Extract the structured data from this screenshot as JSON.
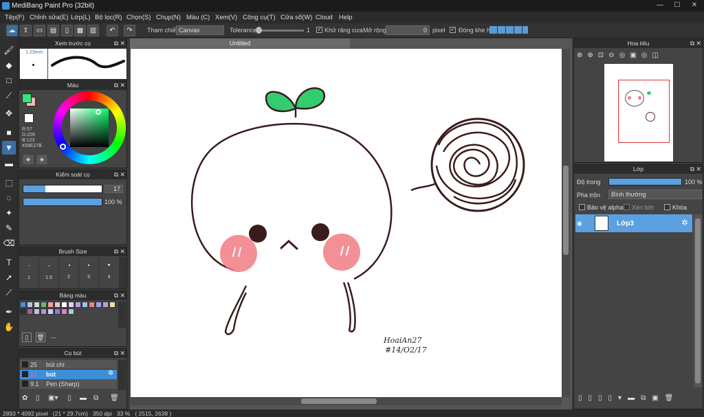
{
  "window": {
    "title": "MediBang Paint Pro (32bit)",
    "min": "—",
    "max": "☐",
    "close": "✕"
  },
  "menu": [
    "Tệp(F)",
    "Chỉnh sửa(E)",
    "Lớp(L)",
    "Bộ lọc(R)",
    "Chọn(S)",
    "Chụp(N)",
    "Màu (C)",
    "Xem(V)",
    "Công cụ(T)",
    "Cửa sổ(W)",
    "Cloud",
    "Help"
  ],
  "toolbar": {
    "reference_label": "Tham chiếu",
    "reference_value": "Canvas",
    "tolerance_label": "Tolerance",
    "tolerance_value": "1",
    "antialias_label": "Khử răng cưa",
    "expand_label": "Mở rộng",
    "expand_value": "0",
    "expand_unit": "pixel",
    "close_gap_label": "Đóng khe hở"
  },
  "brush_preview": {
    "title": "Xem trước cọ",
    "size": "1.23mm"
  },
  "color_panel": {
    "title": "Màu",
    "r": "R:57",
    "g": "G:226",
    "b": "B:123",
    "hex": "#39E27B",
    "primary": "#39E27B",
    "secondary": "#f5b8b8"
  },
  "brush_control": {
    "title": "Kiểm soát cọ",
    "size_value": "17",
    "opacity_value": "100 %",
    "size_fraction": 0.28,
    "opacity_fraction": 1.0
  },
  "brush_size": {
    "title": "Brush Size",
    "sizes": [
      "1",
      "1.5",
      "2",
      "3",
      "4"
    ]
  },
  "palette": {
    "title": "Bảng màu",
    "add_label": "---",
    "colors": [
      "#4a8fd8",
      "#b0c8e8",
      "#d8d8d8",
      "#60c060",
      "#f0a0a0",
      "#f0c0d0",
      "#ffffff",
      "#e0d0f0",
      "#c0a0e0",
      "#a0c0f0",
      "#f08080",
      "#a0a0f0",
      "#c0a0d0",
      "#f0e0a0",
      "#303030",
      "#a060a0",
      "#c0c0f0",
      "#a0a0d0",
      "#d0d0f0",
      "#8080e0",
      "#e080c0",
      "#a0d0e0"
    ]
  },
  "brushes": {
    "title": "Cọ bút",
    "items": [
      {
        "size": "25",
        "name": "bút chì"
      },
      {
        "size": "17",
        "name": "bút"
      },
      {
        "size": "9.1",
        "name": "Pen (Sharp)"
      }
    ]
  },
  "canvas": {
    "tab": "Untitled",
    "signature_line1": "HoaiAn27",
    "signature_line2": "#14/O2/17"
  },
  "navigator": {
    "title": "Hoa tiêu"
  },
  "layers": {
    "title": "Lớp",
    "opacity_label": "Độ trong",
    "opacity_value": "100 %",
    "blend_label": "Pha trộn",
    "blend_value": "Bình thường",
    "protect_alpha": "Bảo vệ alpha",
    "clipping": "Xén bớt",
    "lock": "Khóa",
    "items": [
      {
        "name": "Lớp3"
      }
    ]
  },
  "status": {
    "text": "2893 * 4092 pixel   (21 * 29.7cm)   350 dpi   33 %   ( 2515, 2638 )"
  }
}
